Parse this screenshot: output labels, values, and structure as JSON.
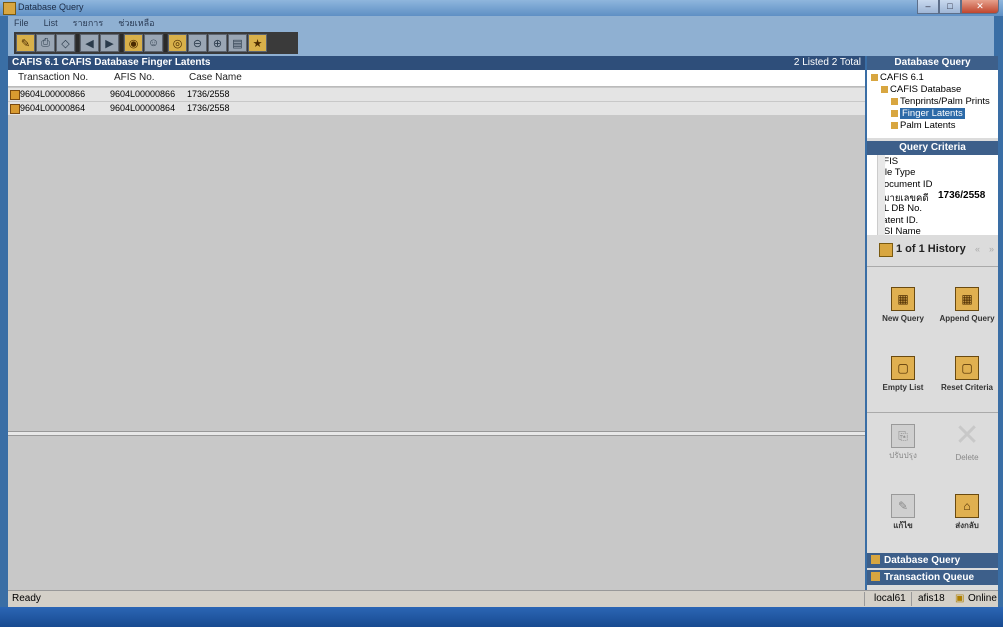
{
  "window": {
    "title": "Database Query"
  },
  "menu": [
    "File",
    "List",
    "รายการ",
    "ช่วยเหลือ"
  ],
  "toolbar": {
    "icons": [
      "open-icon",
      "print-icon",
      "eraser-icon",
      "back-icon",
      "forward-icon",
      "binoculars-icon",
      "people-icon",
      "target-icon",
      "left-circle-icon",
      "right-circle-icon",
      "chart-icon",
      "star-icon"
    ]
  },
  "main": {
    "header": "CAFIS 6.1 CAFIS Database Finger Latents",
    "count": "2 Listed 2 Total",
    "columns": [
      "Transaction No.",
      "AFIS No.",
      "Case Name"
    ],
    "rows": [
      [
        "9604L00000866",
        "9604L00000866",
        "1736/2558"
      ],
      [
        "9604L00000864",
        "9604L00000864",
        "1736/2558"
      ]
    ]
  },
  "status": {
    "ready": "Ready",
    "server": "local61",
    "user": "afis18",
    "online": "Online"
  },
  "sidebar": {
    "db_header": "Database Query",
    "tree": [
      "CAFIS 6.1",
      "CAFIS Database",
      "Tenprints/Palm Prints",
      "Finger Latents",
      "Palm Latents"
    ],
    "criteria_header": "Query Criteria",
    "criteria": [
      {
        "label": "AFIS",
        "value": ""
      },
      {
        "label": "File Type",
        "value": ""
      },
      {
        "label": "Document ID",
        "value": ""
      },
      {
        "label": "หมายเลขคดี",
        "value": "1736/2558"
      },
      {
        "label": "UL DB No.",
        "value": ""
      },
      {
        "label": "Latent ID.",
        "value": ""
      },
      {
        "label": "CSI Name",
        "value": ""
      }
    ],
    "history": "1 of 1 History",
    "actions": {
      "new_query": "New Query",
      "append_query": "Append Query",
      "empty_list": "Empty List",
      "reset_criteria": "Reset Criteria",
      "thai1": "ปรับปรุง",
      "delete": "Delete",
      "edit": "แก้ไข",
      "return": "ส่งกลับ"
    },
    "nav": [
      "Database Query",
      "Transaction Queue"
    ]
  }
}
